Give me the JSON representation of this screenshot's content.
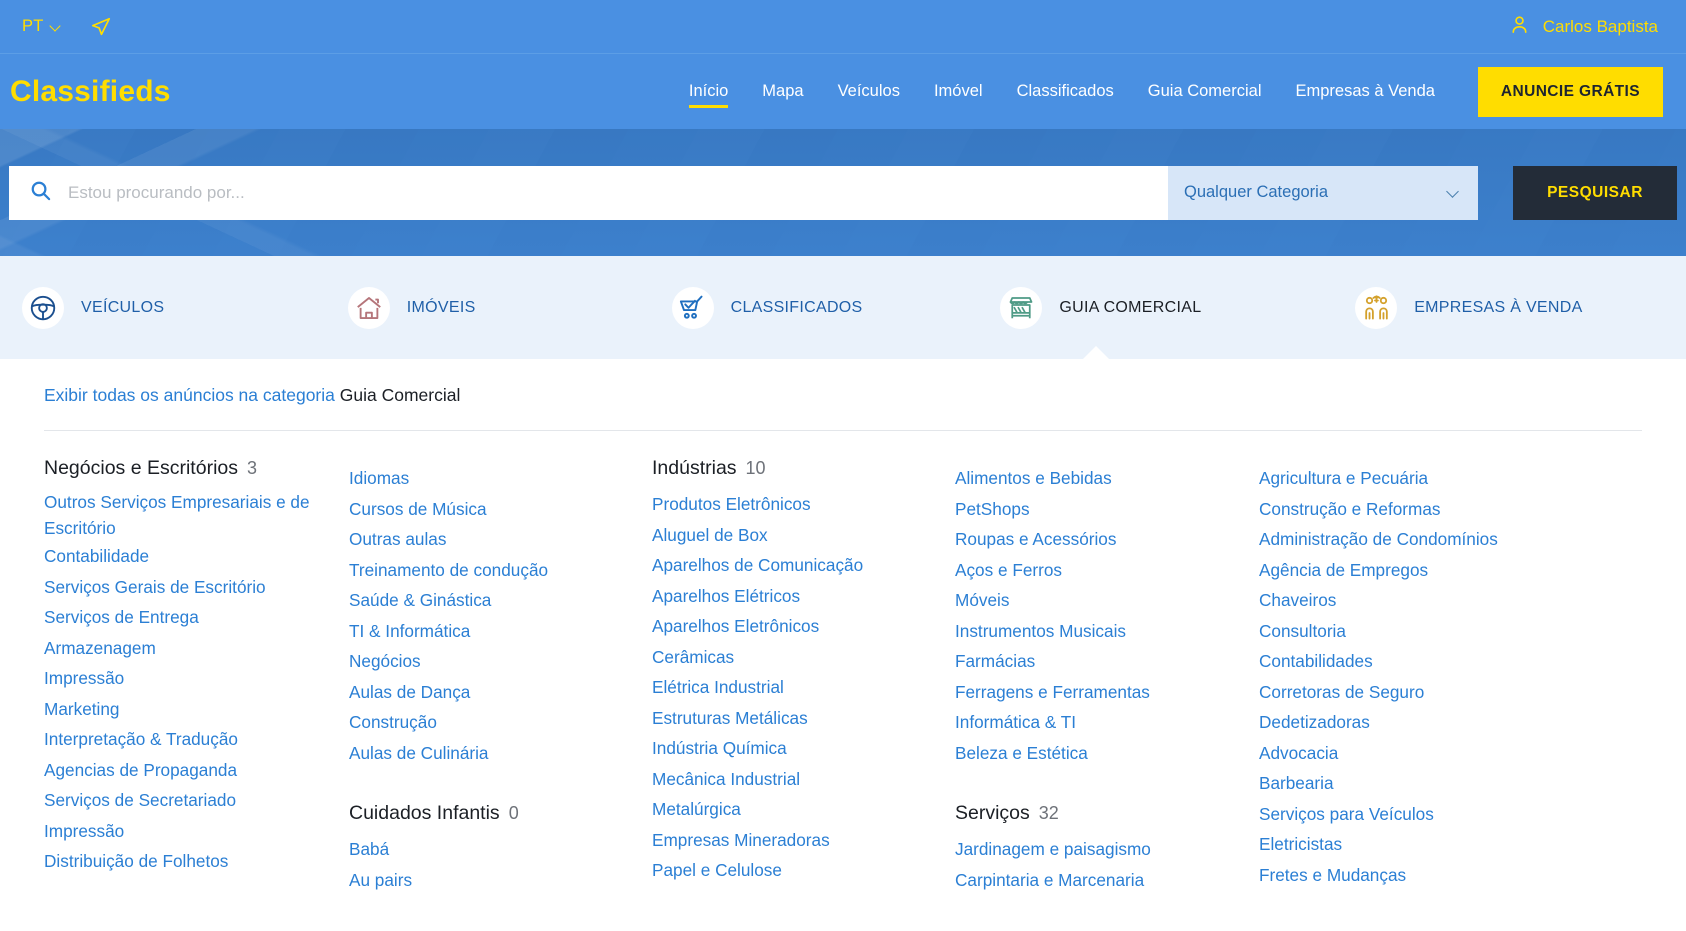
{
  "topbar": {
    "language": "PT",
    "language_icon": "chevron-down-icon",
    "send_icon": "paper-plane-icon",
    "user_icon": "user-avatar-icon",
    "user_name": "Carlos Baptista"
  },
  "header": {
    "brand": "Classifieds",
    "nav": [
      {
        "label": "Início",
        "active": true
      },
      {
        "label": "Mapa",
        "active": false
      },
      {
        "label": "Veículos",
        "active": false
      },
      {
        "label": "Imóvel",
        "active": false
      },
      {
        "label": "Classificados",
        "active": false
      },
      {
        "label": "Guia Comercial",
        "active": false
      },
      {
        "label": "Empresas à Venda",
        "active": false
      }
    ],
    "cta_label": "ANUNCIE GRÁTIS"
  },
  "search": {
    "icon": "search-icon",
    "value": "",
    "placeholder": "Estou procurando por...",
    "category_selected": "Qualquer Categoria",
    "category_chevron": "chevron-down-icon",
    "button_label": "PESQUISAR"
  },
  "tabs": [
    {
      "label": "VEÍCULOS",
      "icon": "steering-wheel-icon",
      "active": false
    },
    {
      "label": "IMÓVEIS",
      "icon": "house-icon",
      "active": false
    },
    {
      "label": "CLASSIFICADOS",
      "icon": "shopping-cart-icon",
      "active": false
    },
    {
      "label": "GUIA COMERCIAL",
      "icon": "market-stall-icon",
      "active": true
    },
    {
      "label": "EMPRESAS À VENDA",
      "icon": "business-people-money-icon",
      "active": false
    }
  ],
  "panel": {
    "show_all_link": "Exibir todas os anúncios na categoria",
    "show_all_category": "Guia Comercial",
    "columns": [
      {
        "groups": [
          {
            "title": "Negócios e Escritórios",
            "count": "3",
            "links": [
              "Outros Serviços Empresariais e de Escritório",
              "Contabilidade",
              "Serviços Gerais de Escritório",
              "Serviços de Entrega",
              "Armazenagem",
              "Impressão",
              "Marketing",
              "Interpretação & Tradução",
              "Agencias de Propaganda",
              "Serviços de Secretariado",
              "Impressão",
              "Distribuição de Folhetos"
            ]
          }
        ]
      },
      {
        "groups": [
          {
            "title": "",
            "count": "",
            "links": [
              "Idiomas",
              "Cursos de Música",
              "Outras aulas",
              "Treinamento de condução",
              "Saúde & Ginástica",
              "TI & Informática",
              "Negócios",
              "Aulas de Dança",
              "Construção",
              "Aulas de Culinária"
            ]
          },
          {
            "title": "Cuidados Infantis",
            "count": "0",
            "links": [
              "Babá",
              "Au pairs"
            ]
          }
        ]
      },
      {
        "groups": [
          {
            "title": "Indústrias",
            "count": "10",
            "links": [
              "Produtos Eletrônicos",
              "Aluguel de Box",
              "Aparelhos de Comunicação",
              "Aparelhos Elétricos",
              "Aparelhos Eletrônicos",
              "Cerâmicas",
              "Elétrica Industrial",
              "Estruturas Metálicas",
              "Indústria Química",
              "Mecânica Industrial",
              "Metalúrgica",
              "Empresas Mineradoras",
              "Papel e Celulose"
            ]
          }
        ]
      },
      {
        "groups": [
          {
            "title": "",
            "count": "",
            "links": [
              "Alimentos e Bebidas",
              "PetShops",
              "Roupas e Acessórios",
              "Aços e Ferros",
              "Móveis",
              "Instrumentos Musicais",
              "Farmácias",
              "Ferragens e Ferramentas",
              "Informática & TI",
              "Beleza e Estética"
            ]
          },
          {
            "title": "Serviços",
            "count": "32",
            "links": [
              "Jardinagem e paisagismo",
              "Carpintaria e Marcenaria"
            ]
          }
        ]
      },
      {
        "groups": [
          {
            "title": "",
            "count": "",
            "links": [
              "Agricultura e Pecuária",
              "Construção e Reformas",
              "Administração de Condomínios",
              "Agência de Empregos",
              "Chaveiros",
              "Consultoria",
              "Contabilidades",
              "Corretoras de Seguro",
              "Dedetizadoras",
              "Advocacia",
              "Barbearia",
              "Serviços para Veículos",
              "Eletricistas",
              "Fretes e Mudanças"
            ]
          }
        ]
      }
    ]
  },
  "colors": {
    "brand_blue": "#4a90e2",
    "accent_yellow": "#ffdd00",
    "link_blue": "#2b7fd4",
    "dark_button": "#232c38",
    "tabstrip_bg": "#eaf2fb"
  }
}
